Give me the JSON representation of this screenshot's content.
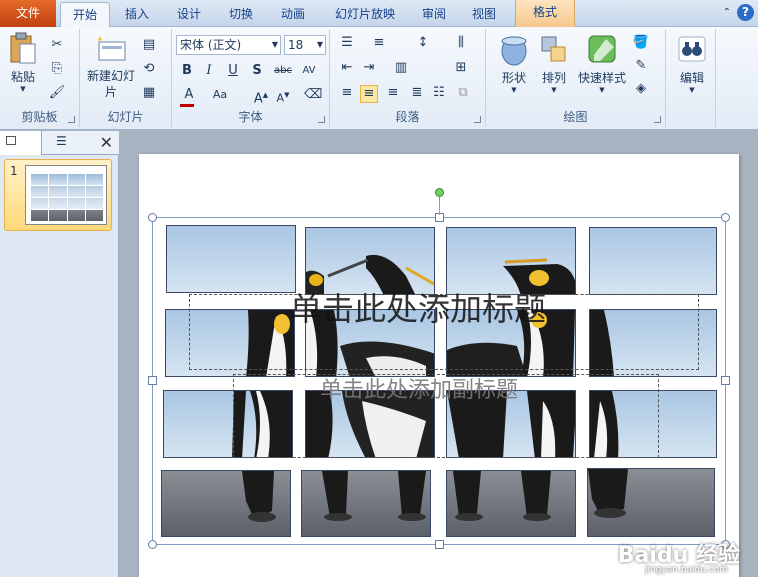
{
  "tabs": [
    "文件",
    "开始",
    "插入",
    "设计",
    "切换",
    "动画",
    "幻灯片放映",
    "审阅",
    "视图",
    "格式"
  ],
  "groups": {
    "clipboard": {
      "label": "剪贴板",
      "paste": "粘贴"
    },
    "slides": {
      "label": "幻灯片",
      "new_slide": "新建幻灯片"
    },
    "font": {
      "label": "字体",
      "font_name": "宋体 (正文)",
      "font_size": "18"
    },
    "paragraph": {
      "label": "段落"
    },
    "drawing": {
      "label": "绘图",
      "shapes": "形状",
      "arrange": "排列",
      "quick_styles": "快速样式"
    },
    "editing": {
      "label": "编辑",
      "edit": "编辑"
    }
  },
  "slide_panel": {
    "slide_number": "1"
  },
  "slide": {
    "title_placeholder": "单击此处添加标题",
    "subtitle_placeholder": "单击此处添加副标题"
  },
  "watermark": {
    "text": "Baidu 经验",
    "sub": "jingyan.baidu.com"
  },
  "colors": {
    "file_tab": "#c2410e",
    "format_tab": "#f6c88e",
    "ribbon_bg": "#e2ebf6",
    "font_color_bar": "#c00000"
  }
}
